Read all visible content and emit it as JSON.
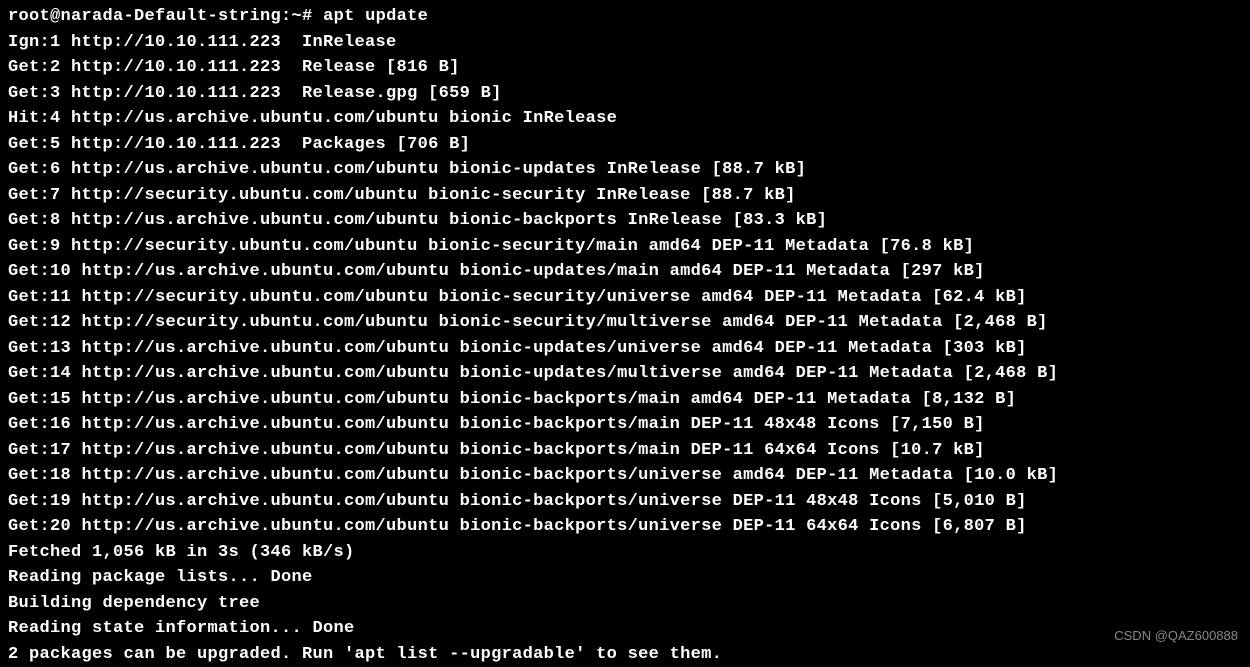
{
  "terminal": {
    "prompt": "root@narada-Default-string:~# ",
    "command": "apt update",
    "output": [
      "Ign:1 http://10.10.111.223  InRelease",
      "Get:2 http://10.10.111.223  Release [816 B]",
      "Get:3 http://10.10.111.223  Release.gpg [659 B]",
      "Hit:4 http://us.archive.ubuntu.com/ubuntu bionic InRelease",
      "Get:5 http://10.10.111.223  Packages [706 B]",
      "Get:6 http://us.archive.ubuntu.com/ubuntu bionic-updates InRelease [88.7 kB]",
      "Get:7 http://security.ubuntu.com/ubuntu bionic-security InRelease [88.7 kB]",
      "Get:8 http://us.archive.ubuntu.com/ubuntu bionic-backports InRelease [83.3 kB]",
      "Get:9 http://security.ubuntu.com/ubuntu bionic-security/main amd64 DEP-11 Metadata [76.8 kB]",
      "Get:10 http://us.archive.ubuntu.com/ubuntu bionic-updates/main amd64 DEP-11 Metadata [297 kB]",
      "Get:11 http://security.ubuntu.com/ubuntu bionic-security/universe amd64 DEP-11 Metadata [62.4 kB]",
      "Get:12 http://security.ubuntu.com/ubuntu bionic-security/multiverse amd64 DEP-11 Metadata [2,468 B]",
      "Get:13 http://us.archive.ubuntu.com/ubuntu bionic-updates/universe amd64 DEP-11 Metadata [303 kB]",
      "Get:14 http://us.archive.ubuntu.com/ubuntu bionic-updates/multiverse amd64 DEP-11 Metadata [2,468 B]",
      "Get:15 http://us.archive.ubuntu.com/ubuntu bionic-backports/main amd64 DEP-11 Metadata [8,132 B]",
      "Get:16 http://us.archive.ubuntu.com/ubuntu bionic-backports/main DEP-11 48x48 Icons [7,150 B]",
      "Get:17 http://us.archive.ubuntu.com/ubuntu bionic-backports/main DEP-11 64x64 Icons [10.7 kB]",
      "Get:18 http://us.archive.ubuntu.com/ubuntu bionic-backports/universe amd64 DEP-11 Metadata [10.0 kB]",
      "Get:19 http://us.archive.ubuntu.com/ubuntu bionic-backports/universe DEP-11 48x48 Icons [5,010 B]",
      "Get:20 http://us.archive.ubuntu.com/ubuntu bionic-backports/universe DEP-11 64x64 Icons [6,807 B]",
      "Fetched 1,056 kB in 3s (346 kB/s)",
      "Reading package lists... Done",
      "Building dependency tree",
      "Reading state information... Done",
      "2 packages can be upgraded. Run 'apt list --upgradable' to see them."
    ]
  },
  "watermark": "CSDN @QAZ600888"
}
